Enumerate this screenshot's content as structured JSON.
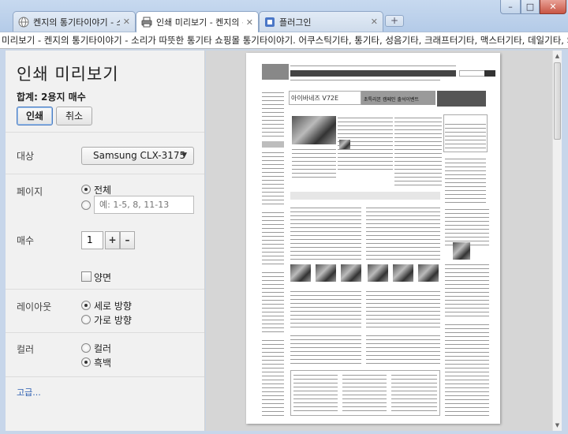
{
  "tabs": [
    {
      "label": "켄지의 통기타이야기 - 소리",
      "icon": "globe-icon",
      "active": false
    },
    {
      "label": "인쇄 미리보기 - 켄지의 통",
      "icon": "printer-icon",
      "active": true
    },
    {
      "label": "플러그인",
      "icon": "puzzle-icon",
      "active": false
    }
  ],
  "new_tab_label": "+",
  "window_controls": {
    "minimize": "–",
    "maximize": "□",
    "close": "✕"
  },
  "page_title": "미리보기 - 켄지의 통기타이야기 - 소리가 따뜻한 통기타 쇼핑몰 통기타이야기. 어쿠스틱기타, 통기타, 성음기타, 크래프터기타, 맥스터기타, 데일기타, 와이만기타 전문",
  "print": {
    "title": "인쇄 미리보기",
    "total": "합계: 2용지 매수",
    "print_button": "인쇄",
    "cancel_button": "취소",
    "destination_label": "대상",
    "destination_value": "Samsung CLX-3175",
    "pages_label": "페이지",
    "pages_all": "전체",
    "pages_placeholder": "예: 1-5, 8, 11-13",
    "copies_label": "매수",
    "copies_value": "1",
    "copies_plus": "+",
    "copies_minus": "–",
    "collate_label": "양면",
    "layout_label": "레이아웃",
    "layout_portrait": "세로 방향",
    "layout_landscape": "가로 방향",
    "color_label": "컬러",
    "color_color": "컬러",
    "color_bw": "흑백",
    "advanced_link": "고급..."
  },
  "preview": {
    "banner_text": "아이바네즈 V72E",
    "banner_right": "초특리본 캠페인 출석이벤트"
  }
}
